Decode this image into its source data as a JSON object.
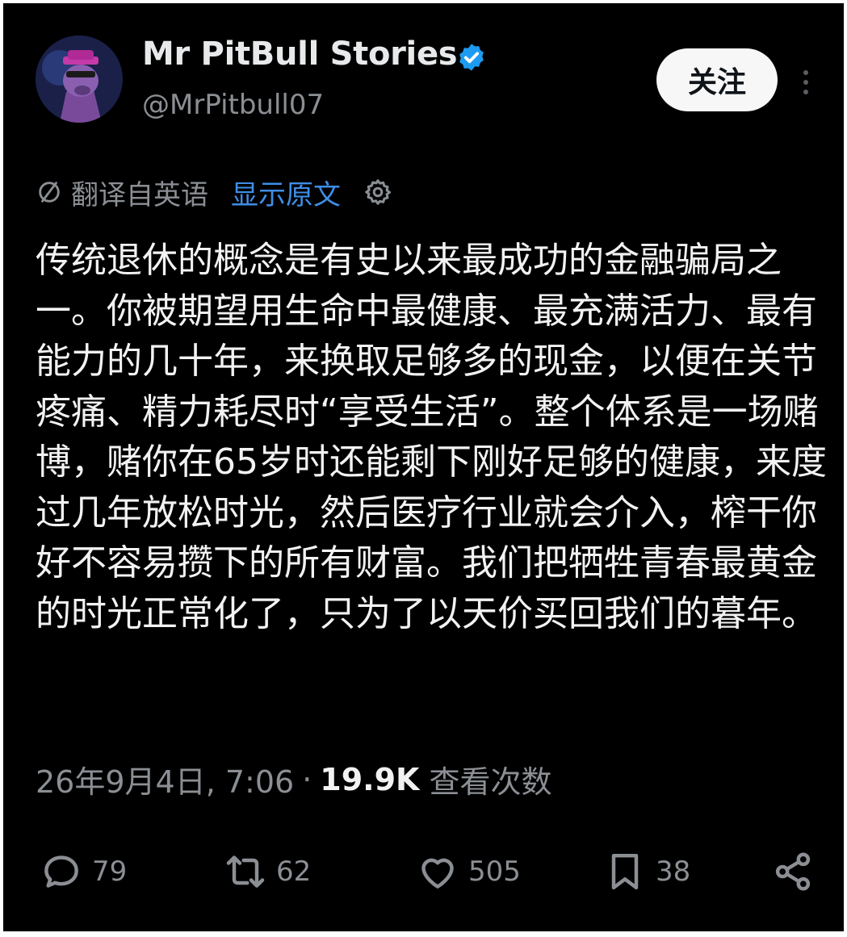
{
  "author": {
    "display_name": "Mr PitBull Stories",
    "handle": "@MrPitbull07",
    "verified": true
  },
  "header": {
    "follow_label": "关注",
    "more_icon": "more-vertical-icon"
  },
  "translation": {
    "translated_label": "翻译自英语",
    "show_original_label": "显示原文",
    "icon": "translate-icon",
    "settings_icon": "gear-icon"
  },
  "tweet": {
    "text": "传统退休的概念是有史以来最成功的金融骗局之一。你被期望用生命中最健康、最充满活力、最有能力的几十年，来换取足够多的现金，以便在关节疼痛、精力耗尽时“享受生活”。整个体系是一场赌博，赌你在65岁时还能剩下刚好足够的健康，来度过几年放松时光，然后医疗行业就会介入，榨干你好不容易攒下的所有财富。我们把牺牲青春最黄金的时光正常化了，只为了以天价买回我们的暮年。",
    "timestamp": "26年9月4日, 7:06",
    "separator": "·",
    "views_count": "19.9K",
    "views_label": "查看次数"
  },
  "actions": {
    "replies": "79",
    "retweets": "62",
    "likes": "505",
    "bookmarks": "38"
  },
  "colors": {
    "background": "#000000",
    "primary_text": "#e7e9ea",
    "secondary_text": "#8b8f94",
    "link": "#3f8ee6",
    "verified_badge": "#1d9bf0",
    "follow_button_bg": "#f7f7f7"
  }
}
